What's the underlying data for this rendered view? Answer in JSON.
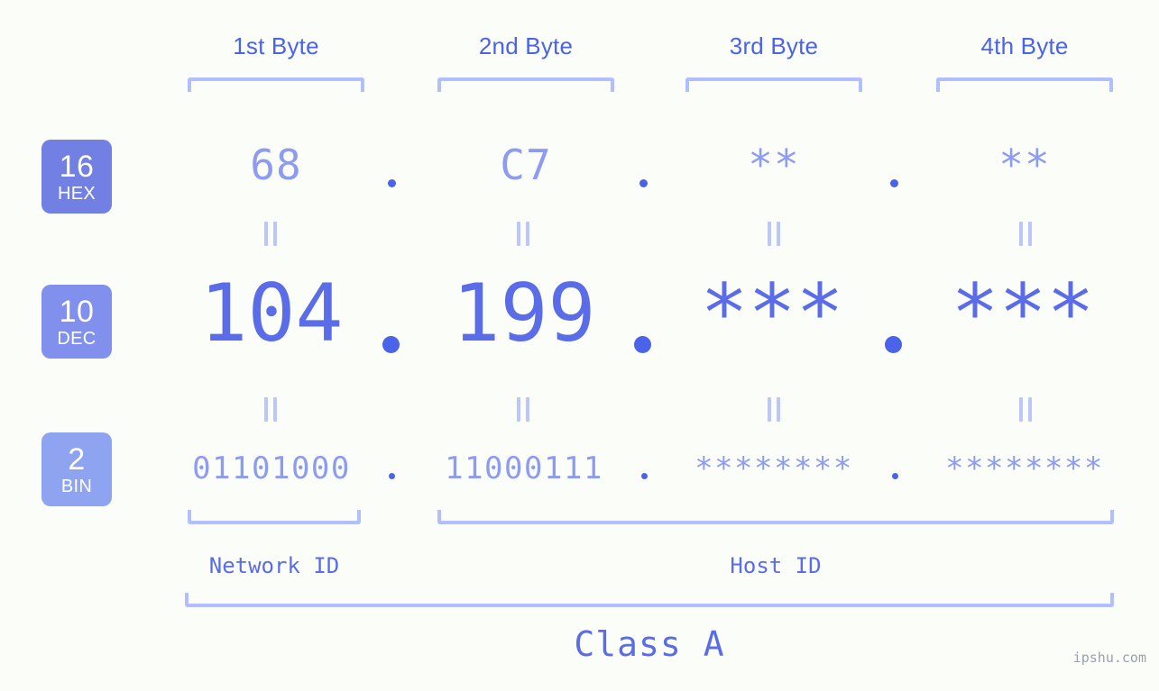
{
  "background_color": "#fbfdf8",
  "accent_color": "#5a6ce8",
  "light_accent_color": "#8d9bf0",
  "bracket_color": "#b3beff",
  "byte_headers": [
    {
      "label": "1st Byte"
    },
    {
      "label": "2nd Byte"
    },
    {
      "label": "3rd Byte"
    },
    {
      "label": "4th Byte"
    }
  ],
  "bases": [
    {
      "num": "16",
      "abbr": "HEX",
      "color": "#7280e3"
    },
    {
      "num": "10",
      "abbr": "DEC",
      "color": "#8190ec"
    },
    {
      "num": "2",
      "abbr": "BIN",
      "color": "#8fa4f0"
    }
  ],
  "rows": {
    "hex": {
      "values": [
        "68",
        "C7",
        "**",
        "**"
      ]
    },
    "dec": {
      "values": [
        "104",
        "199",
        "***",
        "***"
      ]
    },
    "bin": {
      "values": [
        "01101000",
        "11000111",
        "********",
        "********"
      ]
    }
  },
  "separators": {
    "symbol": "."
  },
  "equals_symbol": "||",
  "segments": [
    {
      "label": "Network ID"
    },
    {
      "label": "Host ID"
    }
  ],
  "class": {
    "label": "Class A"
  },
  "watermark": {
    "text": "ipshu.com"
  }
}
